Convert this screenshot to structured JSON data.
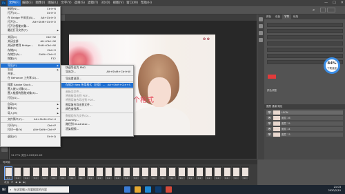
{
  "menubar": {
    "items": [
      "文件(F)",
      "编辑(E)",
      "图像(I)",
      "图层(L)",
      "文字(Y)",
      "选择(S)",
      "滤镜(T)",
      "3D(D)",
      "视图(V)",
      "窗口(W)",
      "帮助(H)"
    ],
    "window_controls": [
      "—",
      "□",
      "✕"
    ]
  },
  "document": {
    "tab_label": "...",
    "status": "34.77%   文档:1.02M/20.1M"
  },
  "file_menu": {
    "items": [
      {
        "label": "新建(N)...",
        "shortcut": "Ctrl+N"
      },
      {
        "label": "打开(O)...",
        "shortcut": "Ctrl+O"
      },
      {
        "label": "在 Bridge 中浏览(B)...",
        "shortcut": "Alt+Ctrl+O"
      },
      {
        "label": "打开为...",
        "shortcut": "Alt+Shift+Ctrl+O"
      },
      {
        "label": "打开为智能对象...",
        "shortcut": ""
      },
      {
        "label": "最近打开文件(T)",
        "shortcut": ""
      },
      {
        "label": "关闭(C)",
        "shortcut": "Ctrl+W"
      },
      {
        "label": "关闭全部",
        "shortcut": "Alt+Ctrl+W"
      },
      {
        "label": "关闭并转到 Bridge...",
        "shortcut": "Shift+Ctrl+W"
      },
      {
        "label": "存储(S)",
        "shortcut": "Ctrl+S"
      },
      {
        "label": "存储为(A)...",
        "shortcut": "Shift+Ctrl+S"
      },
      {
        "label": "恢复(V)",
        "shortcut": "F12"
      },
      {
        "label": "导出(E)",
        "shortcut": ""
      },
      {
        "label": "生成",
        "shortcut": ""
      },
      {
        "label": "共享...",
        "shortcut": ""
      },
      {
        "label": "在 Behance 上共享(D)...",
        "shortcut": ""
      },
      {
        "label": "搜索 Adobe Stock...",
        "shortcut": ""
      },
      {
        "label": "置入嵌入对象(L)...",
        "shortcut": ""
      },
      {
        "label": "置入链接的智能对象(K)...",
        "shortcut": ""
      },
      {
        "label": "打包(G)...",
        "shortcut": ""
      },
      {
        "label": "自动(U)",
        "shortcut": ""
      },
      {
        "label": "脚本(R)",
        "shortcut": ""
      },
      {
        "label": "导入(M)",
        "shortcut": ""
      },
      {
        "label": "文件简介(F)...",
        "shortcut": "Alt+Shift+Ctrl+I"
      },
      {
        "label": "打印(P)...",
        "shortcut": "Ctrl+P"
      },
      {
        "label": "打印一份(Y)",
        "shortcut": "Alt+Shift+Ctrl+P"
      },
      {
        "label": "退出(X)",
        "shortcut": "Ctrl+Q"
      }
    ]
  },
  "export_menu": {
    "items": [
      {
        "label": "快速导出为 PNG",
        "shortcut": ""
      },
      {
        "label": "导出为...",
        "shortcut": "Alt+Shift+Ctrl+W"
      },
      {
        "label": "导出首选项...",
        "shortcut": ""
      },
      {
        "label": "存储为 Web 所用格式（旧版）...",
        "shortcut": "Alt+Shift+Ctrl+S"
      },
      {
        "label": "画板至文件...",
        "shortcut": ""
      },
      {
        "label": "将画板导出到 PDF...",
        "shortcut": ""
      },
      {
        "label": "将图层复合导出到 PDF...",
        "shortcut": ""
      },
      {
        "label": "图层复合导出到文件...",
        "shortcut": ""
      },
      {
        "label": "颜色查找表...",
        "shortcut": ""
      },
      {
        "label": "数据组作为文件(D)...",
        "shortcut": ""
      },
      {
        "label": "Zoomify...",
        "shortcut": ""
      },
      {
        "label": "路径到 Illustrator...",
        "shortcut": ""
      },
      {
        "label": "渲染视频...",
        "shortcut": ""
      }
    ]
  },
  "annotation": "导出这个格式",
  "right_panel": {
    "tabs": [
      "颜色",
      "色板",
      "字符",
      "段落"
    ],
    "section_label": "颜色调整",
    "layers_header": "图层 通道 路径",
    "layers": [
      "LEON",
      "图层 16",
      "图层 15",
      "图层 14",
      "图层 13"
    ],
    "color_chip_pct": "84%",
    "color_chip_sub": "下载速度",
    "accent_color": "#e23b3b"
  },
  "timeline": {
    "header": "时间轴",
    "frames": [
      "0.1",
      "0.1",
      "0.1",
      "0.1",
      "0.1",
      "0.1",
      "0.1",
      "0.1",
      "0.1",
      "0.1",
      "0.1",
      "0.1",
      "0.1",
      "0.1",
      "0.1",
      "0.1",
      "0.1",
      "0.1",
      "0.1",
      "0.1",
      "0.1",
      "0.1",
      "0.1",
      "0.1",
      "0.1",
      "0.1",
      "0.1"
    ],
    "loop_label": "永远"
  },
  "taskbar": {
    "search_placeholder": "在这里输入你要搜索的内容",
    "time": "21:03",
    "date": "2020/2/10"
  }
}
